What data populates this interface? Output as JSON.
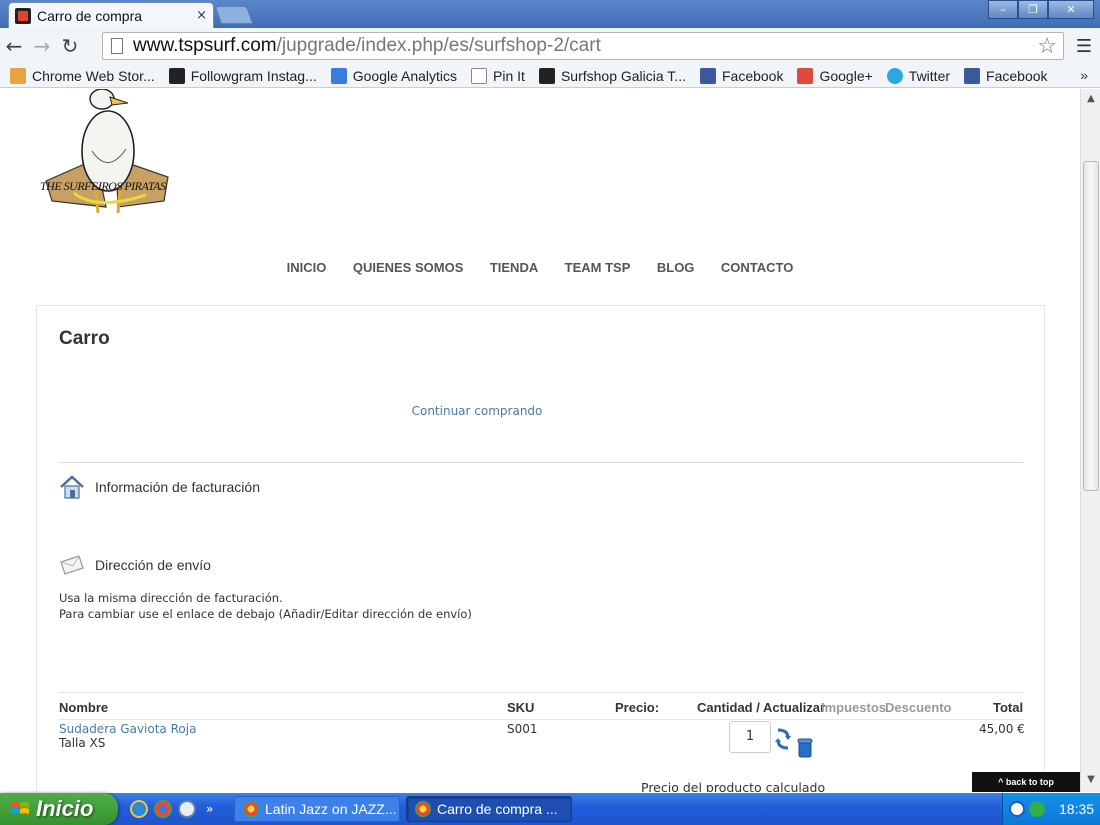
{
  "browser": {
    "tab_title": "Carro de compra",
    "tab_close": "×",
    "url_host": "www.tspsurf.com",
    "url_path": "/jupgrade/index.php/es/surfshop-2/cart",
    "window_buttons": [
      "–",
      "❐",
      "✕"
    ]
  },
  "bookmarks": [
    {
      "label": "Chrome Web Stor...",
      "color": "#e8a33a"
    },
    {
      "label": "Followgram Instag...",
      "color": "#222222"
    },
    {
      "label": "Google Analytics",
      "color": "#3a7de0"
    },
    {
      "label": "Pin It",
      "color": "#ffffff"
    },
    {
      "label": "Surfshop Galicia T...",
      "color": "#222222"
    },
    {
      "label": "Facebook",
      "color": "#3b5998"
    },
    {
      "label": "Google+",
      "color": "#dd4b39"
    },
    {
      "label": "Twitter",
      "color": "#2aa9e0"
    },
    {
      "label": "Facebook",
      "color": "#3b5998"
    }
  ],
  "bookmarks_more": "»",
  "logo_text": "THE SURFEIROS PIRATAS",
  "nav": [
    "INICIO",
    "QUIENES SOMOS",
    "TIENDA",
    "TEAM TSP",
    "BLOG",
    "CONTACTO"
  ],
  "cart": {
    "title": "Carro",
    "continue_link": "Continuar comprando",
    "billing_label": "Información de facturación",
    "shipping_label": "Dirección de envío",
    "shipping_note_1": "Usa la misma dirección de facturación.",
    "shipping_note_2": "Para cambiar use el enlace de debajo (Añadir/Editar dirección de envío)",
    "columns": {
      "name": "Nombre",
      "sku": "SKU",
      "price": "Precio:",
      "qty": "Cantidad / Actualizar",
      "tax": "Impuestos",
      "discount": "Descuento",
      "total": "Total"
    },
    "item": {
      "name": "Sudadera Gaviota Roja",
      "variant": "Talla XS",
      "sku": "S001",
      "qty": "1",
      "total": "45,00 €"
    },
    "calc_note": "Precio del producto calculado"
  },
  "back_to_top": "^ back to top",
  "taskbar": {
    "start": "Inicio",
    "tasks": [
      "Latin Jazz on JAZZ...",
      "Carro de compra ..."
    ],
    "clock": "18:35",
    "ql_more": "»"
  },
  "colors": {
    "link": "#4a7aa5",
    "nav_text": "#555555",
    "taskbar": "#245edb"
  }
}
